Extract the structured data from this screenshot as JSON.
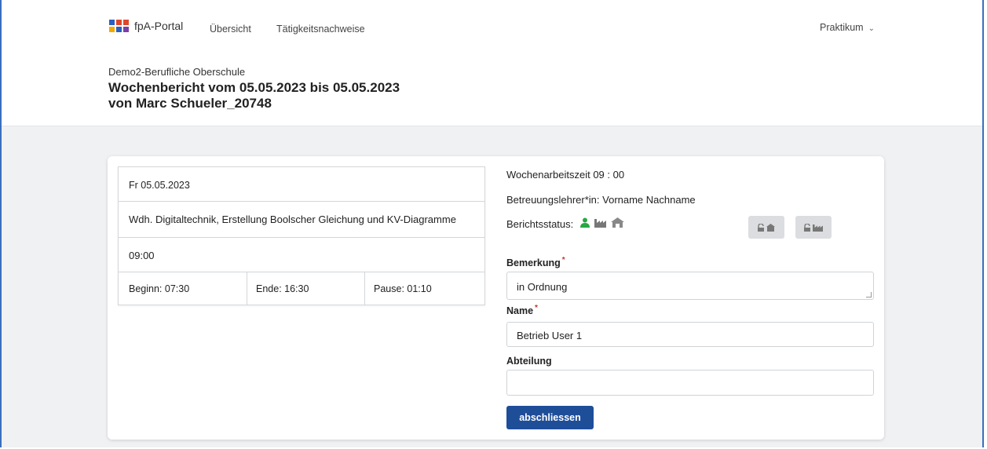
{
  "nav": {
    "brand": "fpA-Portal",
    "links": [
      "Übersicht",
      "Tätigkeitsnachweise"
    ],
    "user_menu": "Praktikum"
  },
  "header": {
    "school": "Demo2-Berufliche Oberschule",
    "title_line1": "Wochenbericht vom 05.05.2023 bis 05.05.2023",
    "title_line2": "von Marc Schueler_20748"
  },
  "day": {
    "date": "Fr 05.05.2023",
    "activity": "Wdh. Digitaltechnik, Erstellung Boolscher Gleichung und KV-Diagramme",
    "duration": "09:00",
    "begin": "Beginn: 07:30",
    "end": "Ende: 16:30",
    "pause": "Pause: 01:10"
  },
  "summary": {
    "weekly_hours": "Wochenarbeitszeit 09 : 00",
    "supervisor": "Betreuungslehrer*in: Vorname Nachname",
    "status_label": "Berichtsstatus:",
    "status_icons": [
      "user-icon",
      "factory-icon",
      "school-icon"
    ],
    "status_colors": {
      "student": "#27a844",
      "company": "#777777",
      "school": "#888888"
    }
  },
  "form": {
    "remark_label": "Bemerkung",
    "remark_value": "in Ordnung",
    "name_label": "Name",
    "name_value": "Betrieb User 1",
    "department_label": "Abteilung",
    "department_value": "",
    "required_marker": "*",
    "submit_label": "abschliessen"
  },
  "colors": {
    "primary": "#1f4e99",
    "required": "#c0392b"
  }
}
